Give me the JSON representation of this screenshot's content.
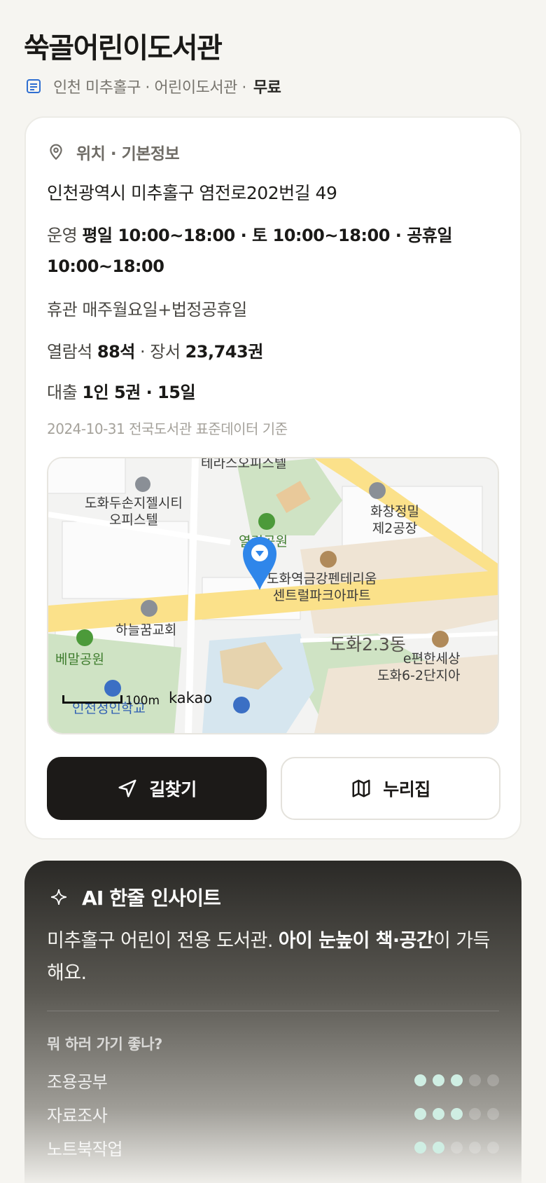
{
  "header": {
    "title": "쑥골어린이도서관",
    "region": "인천 미추홀구 · 어린이도서관 ·",
    "fee": "무료"
  },
  "info": {
    "section_title": "위치 · 기본정보",
    "address": "인천광역시 미추홀구 염전로202번길 49",
    "hours_label": "운영",
    "hours_value": "평일 10:00~18:00 · 토 10:00~18:00 · 공휴일 10:00~18:00",
    "closed_label": "휴관",
    "closed_value": "매주월요일+법정공휴일",
    "seats_label": "열람석",
    "seats_value": "88석",
    "books_sep": "· 장서",
    "books_value": "23,743권",
    "loan_label": "대출",
    "loan_value": "1인 5권 · 15일",
    "source": "2024-10-31 전국도서관 표준데이터 기준"
  },
  "map": {
    "labels": {
      "terrace": "테라스오피스텔",
      "dohwa_jell_1": "도화두손지젤시티",
      "dohwa_jell_2": "오피스텔",
      "hwachang_1": "화창정밀",
      "hwachang_2": "제2공장",
      "park": "열림공원",
      "apt_1": "도화역금강펜테리움",
      "apt_2": "센트럴파크아파트",
      "church": "하늘꿈교회",
      "bemal": "베말공원",
      "district": "도화2.3동",
      "epyeon_1": "e편한세상",
      "epyeon_2": "도화6-2단지아",
      "school": "인천정인학교",
      "scale": "100m",
      "brand": "kakao"
    }
  },
  "actions": {
    "directions": "길찾기",
    "nuri": "누리집"
  },
  "ai": {
    "title": "AI 한줄 인사이트",
    "text_1": "미추홀구 어린이 전용 도서관. ",
    "text_bold": "아이 눈높이 책·공간",
    "text_2": "이 가득해요.",
    "question": "뭐 하러 가기 좋나?",
    "activities": [
      {
        "name": "조용공부",
        "score": 3
      },
      {
        "name": "자료조사",
        "score": 3
      },
      {
        "name": "노트북작업",
        "score": 2
      }
    ],
    "max_score": 5,
    "accent": "#cfeee3"
  }
}
